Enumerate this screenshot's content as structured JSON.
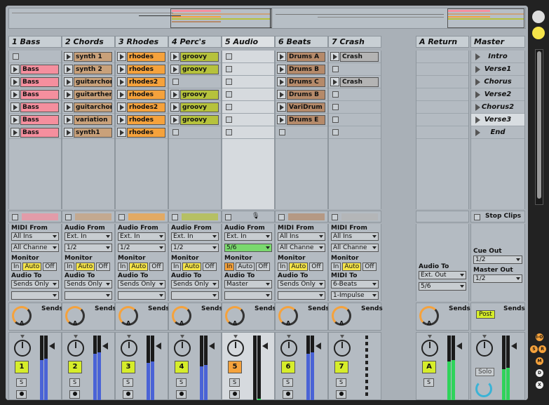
{
  "tracks": [
    {
      "name": "1 Bass",
      "clip_color": "#f58f9e",
      "first_slot_empty": true,
      "clips": [
        "Bass",
        "Bass",
        "Bass",
        "Bass",
        "Bass",
        "Bass"
      ],
      "io": {
        "from_label": "MIDI From",
        "from": "All Ins",
        "chan": "All Channe",
        "monitor": "Monitor",
        "auto": "Auto",
        "in": "In",
        "off": "Off",
        "to_label": "Audio To",
        "to": "Sends Only",
        "to2": ""
      },
      "sends": "Sends",
      "knob": "A",
      "number": "1",
      "solo": "S"
    },
    {
      "name": "2 Chords",
      "clip_color": "#c9a17a",
      "clips": [
        "synth 1",
        "synth 2",
        "guitarchorus",
        "guitartheme",
        "guitarchorus",
        "variation",
        "synth1"
      ],
      "io": {
        "from_label": "Audio From",
        "from": "Ext. In",
        "chan": "1/2",
        "monitor": "Monitor",
        "auto": "Auto",
        "in": "In",
        "off": "Off",
        "to_label": "Audio To",
        "to": "Sends Only",
        "to2": ""
      },
      "sends": "Sends",
      "knob": "A",
      "number": "2",
      "solo": "S"
    },
    {
      "name": "3 Rhodes",
      "clip_color": "#f5a23c",
      "clips": [
        "rhodes",
        "rhodes",
        "rhodes2",
        "rhodes",
        "rhodes2",
        "rhodes",
        "rhodes"
      ],
      "io": {
        "from_label": "Audio From",
        "from": "Ext. In",
        "chan": "1/2",
        "monitor": "Monitor",
        "auto": "Auto",
        "in": "In",
        "off": "Off",
        "to_label": "Audio To",
        "to": "Sends Only",
        "to2": ""
      },
      "sends": "Sends",
      "knob": "A",
      "number": "3",
      "solo": "S"
    },
    {
      "name": "4 Perc's",
      "clip_color": "#b6c23c",
      "clips": [
        "groovy",
        "groovy",
        "",
        "groovy",
        "groovy",
        "groovy",
        ""
      ],
      "io": {
        "from_label": "Audio From",
        "from": "Ext. In",
        "chan": "1/2",
        "monitor": "Monitor",
        "auto": "Auto",
        "in": "In",
        "off": "Off",
        "to_label": "Audio To",
        "to": "Sends Only",
        "to2": ""
      },
      "sends": "Sends",
      "knob": "A",
      "number": "4",
      "solo": "S"
    },
    {
      "name": "5 Audio",
      "clip_color": "",
      "clips": [],
      "io": {
        "from_label": "Audio From",
        "from": "Ext. In",
        "chan": "5/6",
        "monitor": "Monitor",
        "auto": "Auto",
        "in": "In",
        "off": "Off",
        "to_label": "Audio To",
        "to": "Master",
        "to2": ""
      },
      "sends": "Sends",
      "knob": "A",
      "number": "5",
      "solo": "S"
    },
    {
      "name": "6 Beats",
      "clip_color": "#b58a6a",
      "clips": [
        "Drums A",
        "Drums B",
        "Drums C",
        "Drums B",
        "VariDrum",
        "Drums E"
      ],
      "io": {
        "from_label": "MIDI From",
        "from": "All Ins",
        "chan": "All Channe",
        "monitor": "Monitor",
        "auto": "Auto",
        "in": "In",
        "off": "Off",
        "to_label": "Audio To",
        "to": "Sends Only",
        "to2": ""
      },
      "sends": "Sends",
      "knob": "A",
      "number": "6",
      "solo": "S"
    },
    {
      "name": "7 Crash",
      "clip_color": "#b4b4b4",
      "clips": [
        "Crash",
        "",
        "Crash",
        "",
        "",
        "",
        ""
      ],
      "io": {
        "from_label": "MIDI From",
        "from": "All Ins",
        "chan": "All Channe",
        "monitor": "Monitor",
        "auto": "Auto",
        "in": "In",
        "off": "Off",
        "to_label": "MIDI To",
        "to": "6-Beats",
        "to2": "1-Impulse"
      },
      "sends": "Sends",
      "knob": "A",
      "number": "7",
      "solo": "S"
    }
  ],
  "return_track": {
    "name": "A Return",
    "audio_to_label": "Audio To",
    "audio_to": "Ext. Out",
    "chan": "5/6",
    "sends": "Sends",
    "number": "A",
    "solo": "S"
  },
  "master": {
    "name": "Master",
    "scenes": [
      "Intro",
      "Verse1",
      "Chorus",
      "Verse2",
      "Chorus2",
      "Verse3",
      "End"
    ],
    "stop_clips": "Stop Clips",
    "cue_out_label": "Cue Out",
    "cue_out": "1/2",
    "master_out_label": "Master Out",
    "master_out": "1/2",
    "sends": "Sends",
    "post": "Post",
    "solo": "Solo"
  },
  "side": {
    "io": "I-O",
    "s": "S",
    "r": "R",
    "m": "M",
    "d": "D",
    "x": "X"
  }
}
